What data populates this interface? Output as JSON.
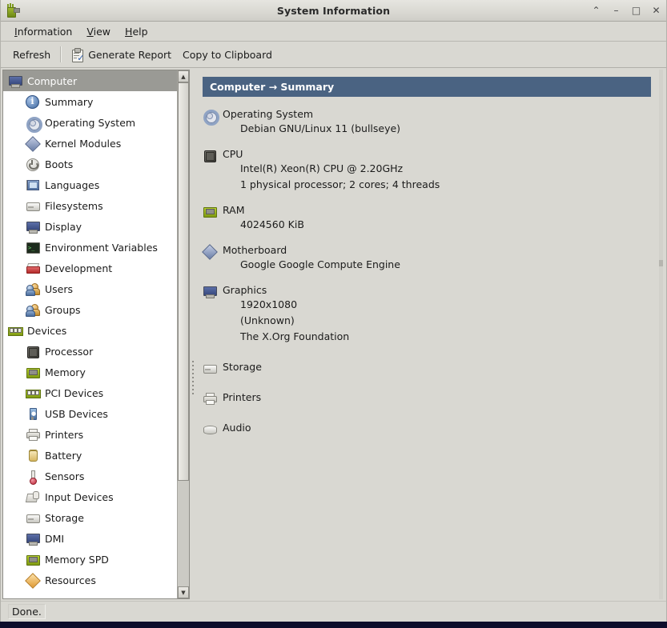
{
  "window": {
    "title": "System Information",
    "app_icon": "hardinfo-icon",
    "buttons": [
      {
        "name": "shade-button",
        "glyph": "⌃"
      },
      {
        "name": "minimize-button",
        "glyph": "–"
      },
      {
        "name": "maximize-button",
        "glyph": "□"
      },
      {
        "name": "close-button",
        "glyph": "✕"
      }
    ]
  },
  "menubar": [
    {
      "name": "menu-information",
      "mnemonic": "I",
      "rest": "nformation"
    },
    {
      "name": "menu-view",
      "mnemonic": "V",
      "rest": "iew"
    },
    {
      "name": "menu-help",
      "mnemonic": "H",
      "rest": "elp"
    }
  ],
  "toolbar": {
    "refresh_label": "Refresh",
    "generate_report_label": "Generate Report",
    "copy_to_clipboard_label": "Copy to Clipboard"
  },
  "sidebar": {
    "groups": [
      {
        "label": "Computer",
        "icon": "monitor-icon",
        "selected": true,
        "items": [
          {
            "label": "Summary",
            "icon": "info-icon"
          },
          {
            "label": "Operating System",
            "icon": "gear-icon"
          },
          {
            "label": "Kernel Modules",
            "icon": "diamond-icon"
          },
          {
            "label": "Boots",
            "icon": "power-icon"
          },
          {
            "label": "Languages",
            "icon": "flag-icon"
          },
          {
            "label": "Filesystems",
            "icon": "harddisk-icon"
          },
          {
            "label": "Display",
            "icon": "monitor-icon"
          },
          {
            "label": "Environment Variables",
            "icon": "terminal-icon"
          },
          {
            "label": "Development",
            "icon": "toolbox-icon"
          },
          {
            "label": "Users",
            "icon": "users-icon"
          },
          {
            "label": "Groups",
            "icon": "users-icon"
          }
        ]
      },
      {
        "label": "Devices",
        "icon": "pci-card-icon",
        "selected": false,
        "items": [
          {
            "label": "Processor",
            "icon": "chip-icon"
          },
          {
            "label": "Memory",
            "icon": "ram-icon"
          },
          {
            "label": "PCI Devices",
            "icon": "pci-card-icon"
          },
          {
            "label": "USB Devices",
            "icon": "usb-icon"
          },
          {
            "label": "Printers",
            "icon": "printer-icon"
          },
          {
            "label": "Battery",
            "icon": "battery-icon"
          },
          {
            "label": "Sensors",
            "icon": "thermometer-icon"
          },
          {
            "label": "Input Devices",
            "icon": "input-devices-icon"
          },
          {
            "label": "Storage",
            "icon": "harddisk-icon"
          },
          {
            "label": "DMI",
            "icon": "computer-icon"
          },
          {
            "label": "Memory SPD",
            "icon": "ram-icon"
          },
          {
            "label": "Resources",
            "icon": "diamond-orange-icon"
          }
        ]
      }
    ]
  },
  "content": {
    "header": "Computer → Summary",
    "sections": [
      {
        "title": "Operating System",
        "icon": "gear-icon",
        "values": [
          "Debian GNU/Linux 11 (bullseye)"
        ]
      },
      {
        "title": "CPU",
        "icon": "chip-icon",
        "values": [
          "Intel(R) Xeon(R) CPU @ 2.20GHz",
          "1 physical processor; 2 cores; 4 threads"
        ]
      },
      {
        "title": "RAM",
        "icon": "ram-icon",
        "values": [
          "4024560 KiB"
        ]
      },
      {
        "title": "Motherboard",
        "icon": "diamond-icon",
        "values": [
          "Google Google Compute Engine"
        ]
      },
      {
        "title": "Graphics",
        "icon": "monitor-icon",
        "values": [
          "1920x1080",
          "(Unknown)",
          "The X.Org Foundation"
        ]
      },
      {
        "title": "Storage",
        "icon": "harddisk-icon",
        "values": []
      },
      {
        "title": "Printers",
        "icon": "printer-icon",
        "values": []
      },
      {
        "title": "Audio",
        "icon": "audio-icon",
        "values": []
      }
    ]
  },
  "statusbar": {
    "message": "Done."
  },
  "colors": {
    "header_bg": "#4a6382",
    "window_bg": "#d9d8d2",
    "selection_bg": "#9a9a95",
    "desktop": "#0d0d2b"
  }
}
